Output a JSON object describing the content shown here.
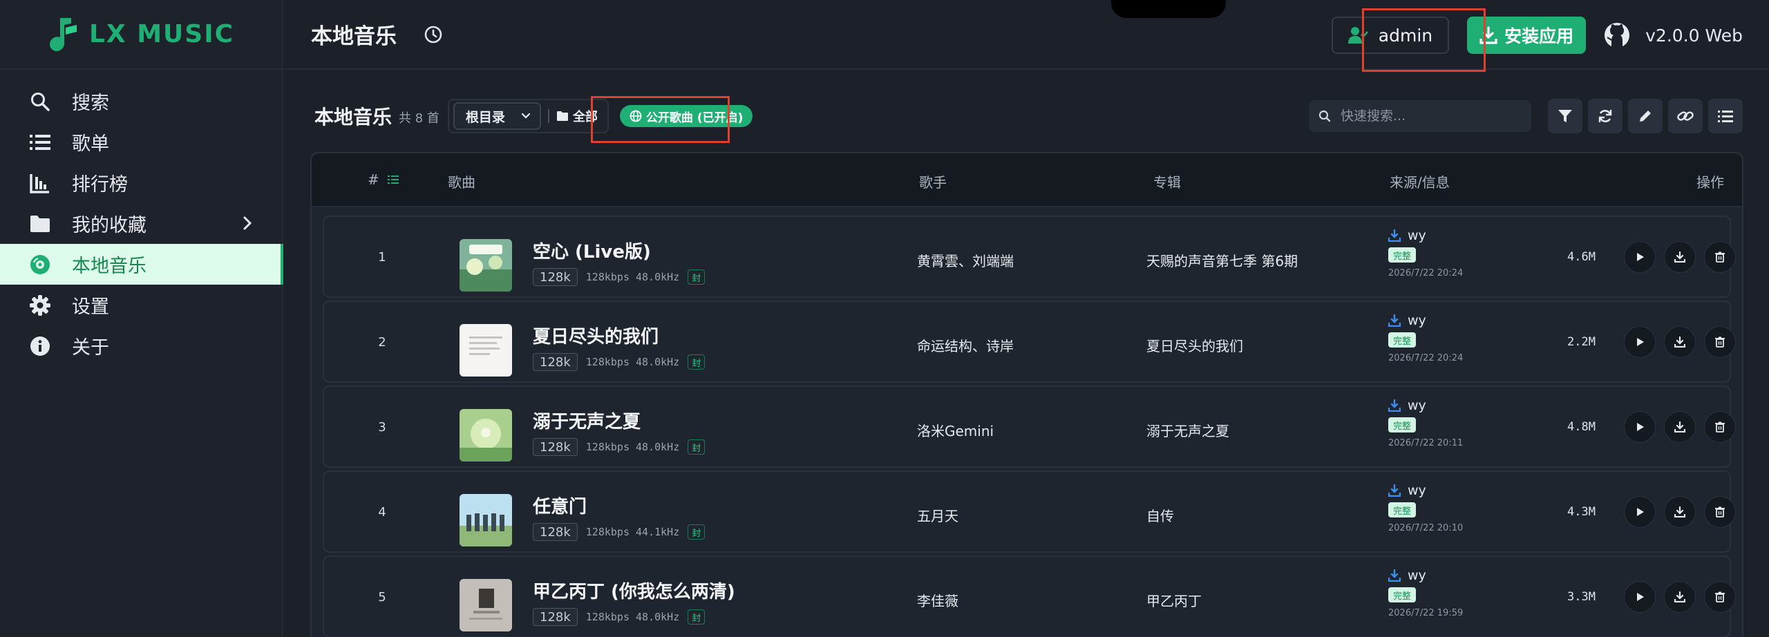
{
  "app": {
    "name": "LX MUSIC",
    "brand_color": "#1fae74"
  },
  "sidebar": {
    "items": [
      {
        "label": "搜索",
        "icon": "search-icon"
      },
      {
        "label": "歌单",
        "icon": "list-icon"
      },
      {
        "label": "排行榜",
        "icon": "chart-icon"
      },
      {
        "label": "我的收藏",
        "icon": "folder-icon",
        "expandable": true
      },
      {
        "label": "本地音乐",
        "icon": "disc-icon",
        "active": true
      },
      {
        "label": "设置",
        "icon": "gear-icon"
      },
      {
        "label": "关于",
        "icon": "info-icon"
      }
    ]
  },
  "header": {
    "title": "本地音乐",
    "user": "admin",
    "install_label": "安装应用",
    "version": "v2.0.0 Web"
  },
  "toolbar": {
    "title": "本地音乐",
    "count": "共 8 首",
    "dir_select": "根目录",
    "all_label": "全部",
    "public_badge": "公开歌曲 (已开启)",
    "search_placeholder": "快速搜索..."
  },
  "table": {
    "columns": {
      "index": "#",
      "song": "歌曲",
      "artist": "歌手",
      "album": "专辑",
      "source": "来源/信息",
      "ops": "操作"
    },
    "rows": [
      {
        "index": "1",
        "title": "空心 (Live版)",
        "quality": "128k",
        "kbps": "128kbps 48.0kHz",
        "cover_tag": "封",
        "artist": "黄霄雲、刘端端",
        "album": "天赐的声音第七季 第6期",
        "source": "wy",
        "status": "完整",
        "time": "2026/7/22 20:24",
        "size": "4.6M"
      },
      {
        "index": "2",
        "title": "夏日尽头的我们",
        "quality": "128k",
        "kbps": "128kbps 48.0kHz",
        "cover_tag": "封",
        "artist": "命运结构、诗岸",
        "album": "夏日尽头的我们",
        "source": "wy",
        "status": "完整",
        "time": "2026/7/22 20:24",
        "size": "2.2M"
      },
      {
        "index": "3",
        "title": "溺于无声之夏",
        "quality": "128k",
        "kbps": "128kbps 48.0kHz",
        "cover_tag": "封",
        "artist": "洛米Gemini",
        "album": "溺于无声之夏",
        "source": "wy",
        "status": "完整",
        "time": "2026/7/22 20:11",
        "size": "4.8M"
      },
      {
        "index": "4",
        "title": "任意门",
        "quality": "128k",
        "kbps": "128kbps 44.1kHz",
        "cover_tag": "封",
        "artist": "五月天",
        "album": "自传",
        "source": "wy",
        "status": "完整",
        "time": "2026/7/22 20:10",
        "size": "4.3M"
      },
      {
        "index": "5",
        "title": "甲乙丙丁 (你我怎么两清)",
        "quality": "128k",
        "kbps": "128kbps 48.0kHz",
        "cover_tag": "封",
        "artist": "李佳薇",
        "album": "甲乙丙丁",
        "source": "wy",
        "status": "完整",
        "time": "2026/7/22 19:59",
        "size": "3.3M"
      }
    ]
  }
}
